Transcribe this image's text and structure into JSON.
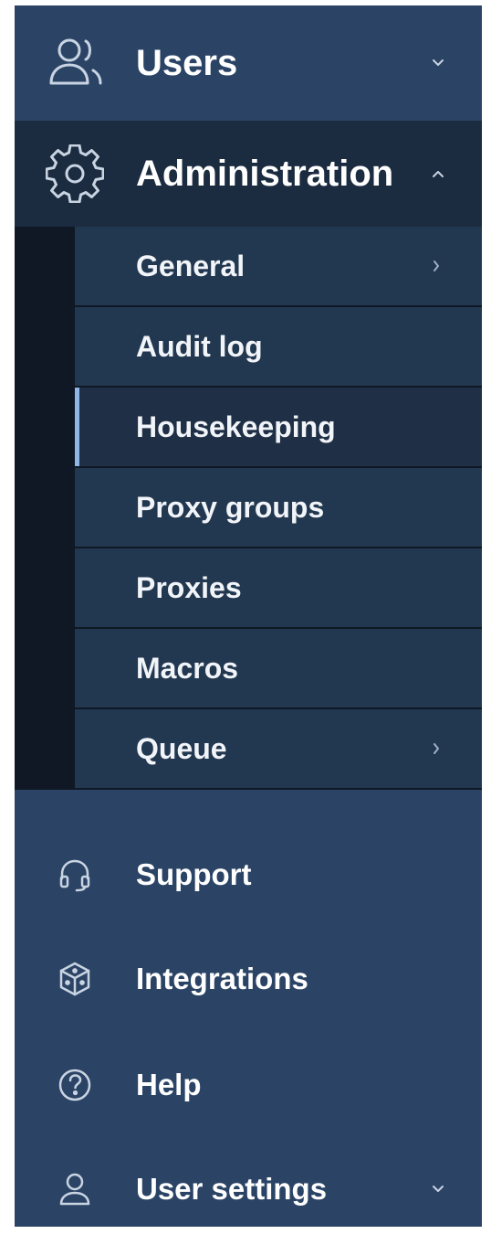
{
  "sidebar": {
    "colors": {
      "background": "#2b4466",
      "expanded_header": "#1b2b40",
      "submenu_item": "#223750",
      "active_indicator": "#8fb6e6"
    },
    "users": {
      "label": "Users",
      "icon": "users-icon",
      "expanded": false
    },
    "administration": {
      "label": "Administration",
      "icon": "gear-icon",
      "expanded": true,
      "items": [
        {
          "label": "General",
          "has_submenu": true,
          "active": false
        },
        {
          "label": "Audit log",
          "has_submenu": false,
          "active": false
        },
        {
          "label": "Housekeeping",
          "has_submenu": false,
          "active": true
        },
        {
          "label": "Proxy groups",
          "has_submenu": false,
          "active": false
        },
        {
          "label": "Proxies",
          "has_submenu": false,
          "active": false
        },
        {
          "label": "Macros",
          "has_submenu": false,
          "active": false
        },
        {
          "label": "Queue",
          "has_submenu": true,
          "active": false
        }
      ]
    },
    "support": {
      "label": "Support",
      "icon": "headset-icon"
    },
    "integrations": {
      "label": "Integrations",
      "icon": "cube-icon"
    },
    "help": {
      "label": "Help",
      "icon": "help-icon"
    },
    "user_settings": {
      "label": "User settings",
      "icon": "user-icon",
      "expanded": false
    }
  }
}
